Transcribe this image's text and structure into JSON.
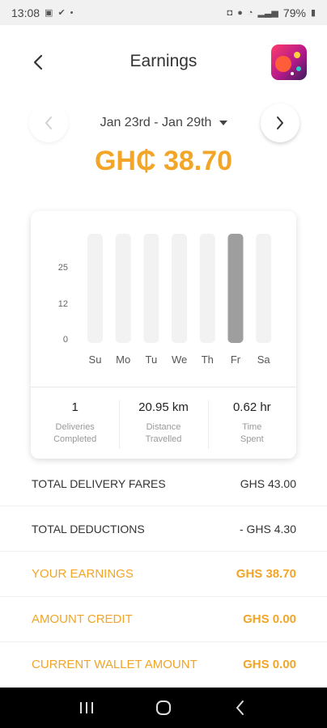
{
  "status": {
    "time": "13:08",
    "battery": "79%"
  },
  "header": {
    "title": "Earnings"
  },
  "period": {
    "label": "Jan 23rd - Jan 29th"
  },
  "total": "GH₵ 38.70",
  "colors": {
    "accent": "#f2a526",
    "bar_bg": "#f2f2f2",
    "bar_active": "#9e9e9e"
  },
  "chart_data": {
    "type": "bar",
    "categories": [
      "Su",
      "Mo",
      "Tu",
      "We",
      "Th",
      "Fr",
      "Sa"
    ],
    "values": [
      0,
      0,
      0,
      0,
      0,
      38.7,
      0
    ],
    "highlight_index": 5,
    "yticks": [
      "25",
      "12",
      "0"
    ],
    "title": "",
    "xlabel": "",
    "ylabel": ""
  },
  "stats": [
    {
      "value": "1",
      "label_line1": "Deliveries",
      "label_line2": "Completed"
    },
    {
      "value": "20.95 km",
      "label_line1": "Distance",
      "label_line2": "Travelled"
    },
    {
      "value": "0.62 hr",
      "label_line1": "Time",
      "label_line2": "Spent"
    }
  ],
  "summary": [
    {
      "label": "TOTAL DELIVERY FARES",
      "value": "GHS 43.00"
    },
    {
      "label": "TOTAL DEDUCTIONS",
      "value": "- GHS 4.30"
    },
    {
      "label": "YOUR EARNINGS",
      "value": "GHS 38.70"
    },
    {
      "label": "AMOUNT CREDIT",
      "value": "GHS 0.00"
    },
    {
      "label": "CURRENT WALLET AMOUNT",
      "value": "GHS 0.00"
    }
  ]
}
